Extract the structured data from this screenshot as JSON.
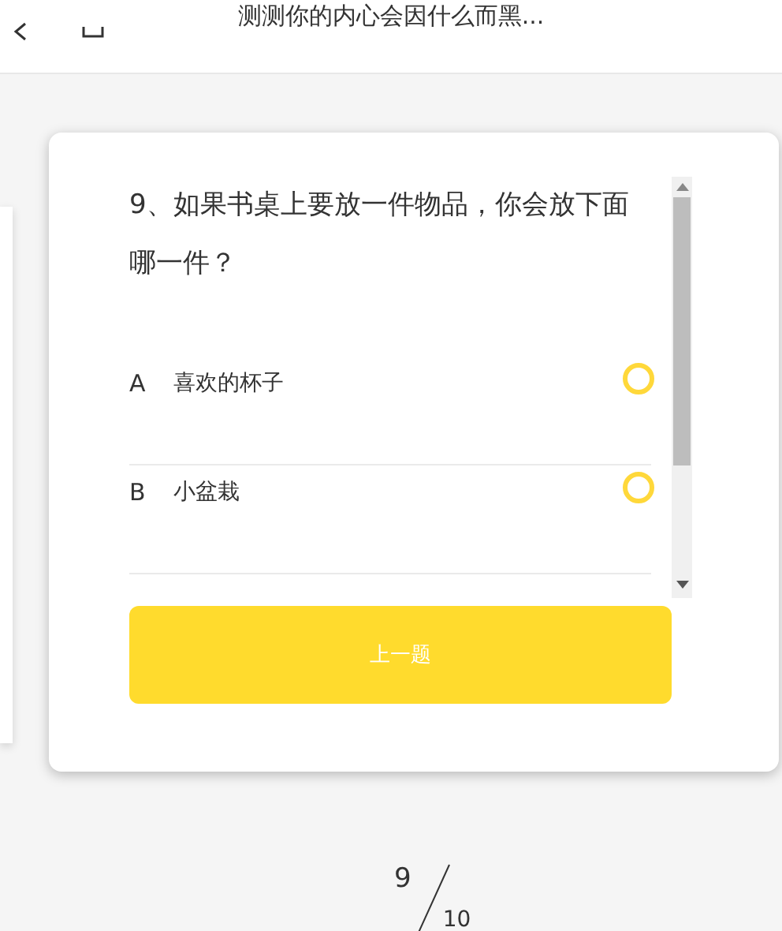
{
  "header": {
    "title": "测测你的内心会因什么而黑..."
  },
  "question": {
    "text": "9、如果书桌上要放一件物品，你会放下面哪一件？",
    "options": [
      {
        "letter": "A",
        "label": "喜欢的杯子",
        "selected": false
      },
      {
        "letter": "B",
        "label": "小盆栽",
        "selected": false
      }
    ]
  },
  "prev_button": "上一题",
  "progress": {
    "current": "9",
    "total": "10"
  }
}
